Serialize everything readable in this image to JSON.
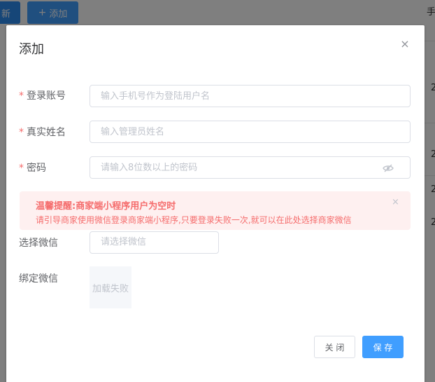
{
  "background": {
    "refresh_label": "新",
    "add_icon": "+",
    "add_label": "添加",
    "header_fragment": "手",
    "row_digits": [
      "2",
      "2",
      "2",
      "2"
    ]
  },
  "dialog": {
    "title": "添加",
    "close_icon": "×",
    "fields": {
      "account": {
        "label": "登录账号",
        "required_mark": "*",
        "placeholder": "输入手机号作为登陆用户名"
      },
      "realname": {
        "label": "真实姓名",
        "required_mark": "*",
        "placeholder": "输入管理员姓名"
      },
      "password": {
        "label": "密码",
        "required_mark": "*",
        "placeholder": "请输入8位数以上的密码"
      }
    },
    "alert": {
      "title": "温馨提醒:商家端小程序用户为空时",
      "description": "请引导商家使用微信登录商家端小程序,只要登录失败一次,就可以在此处选择商家微信",
      "close_icon": "×"
    },
    "select_wechat": {
      "label": "选择微信",
      "placeholder": "请选择微信"
    },
    "bind_wechat": {
      "label": "绑定微信",
      "image_status": "加载失败"
    },
    "buttons": {
      "close": "关 闭",
      "save": "保 存"
    }
  },
  "colors": {
    "primary": "#409eff",
    "danger": "#f56c6c",
    "alert_bg": "#fef0f0",
    "border": "#dcdfe6",
    "placeholder": "#c0c4cc"
  }
}
